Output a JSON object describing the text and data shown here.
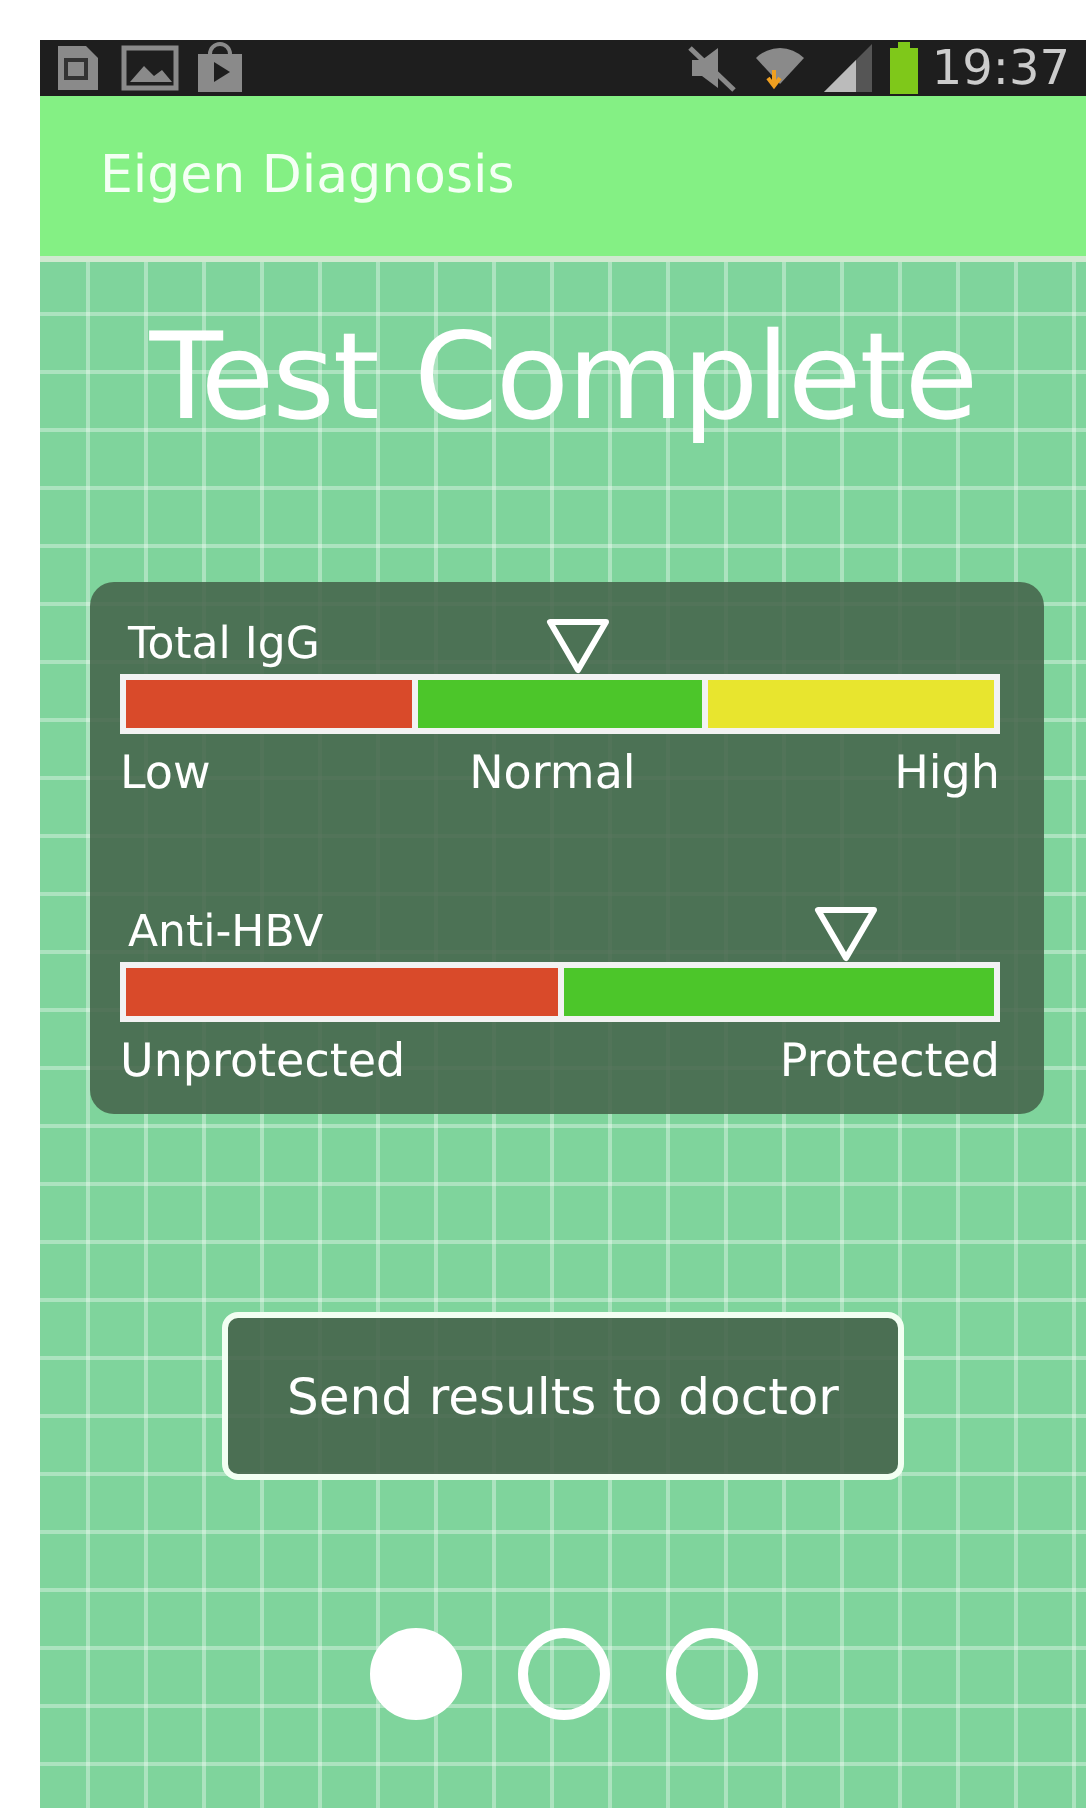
{
  "status_bar": {
    "time": "19:37"
  },
  "app_bar": {
    "title": "Eigen Diagnosis"
  },
  "heading": "Test Complete",
  "meters": [
    {
      "name": "Total IgG",
      "level": 0.52,
      "segments": [
        {
          "label": "Low",
          "color": "#d94a2a"
        },
        {
          "label": "Normal",
          "color": "#4cc62a"
        },
        {
          "label": "High",
          "color": "#e8e52e"
        }
      ]
    },
    {
      "name": "Anti-HBV",
      "level": 0.83,
      "segments": [
        {
          "label": "Unprotected",
          "color": "#d94a2a"
        },
        {
          "label": "Protected",
          "color": "#4cc62a"
        }
      ]
    }
  ],
  "button": {
    "label": "Send results to doctor"
  },
  "pager": [
    {
      "selected": true
    },
    {
      "selected": false
    },
    {
      "selected": false
    }
  ]
}
